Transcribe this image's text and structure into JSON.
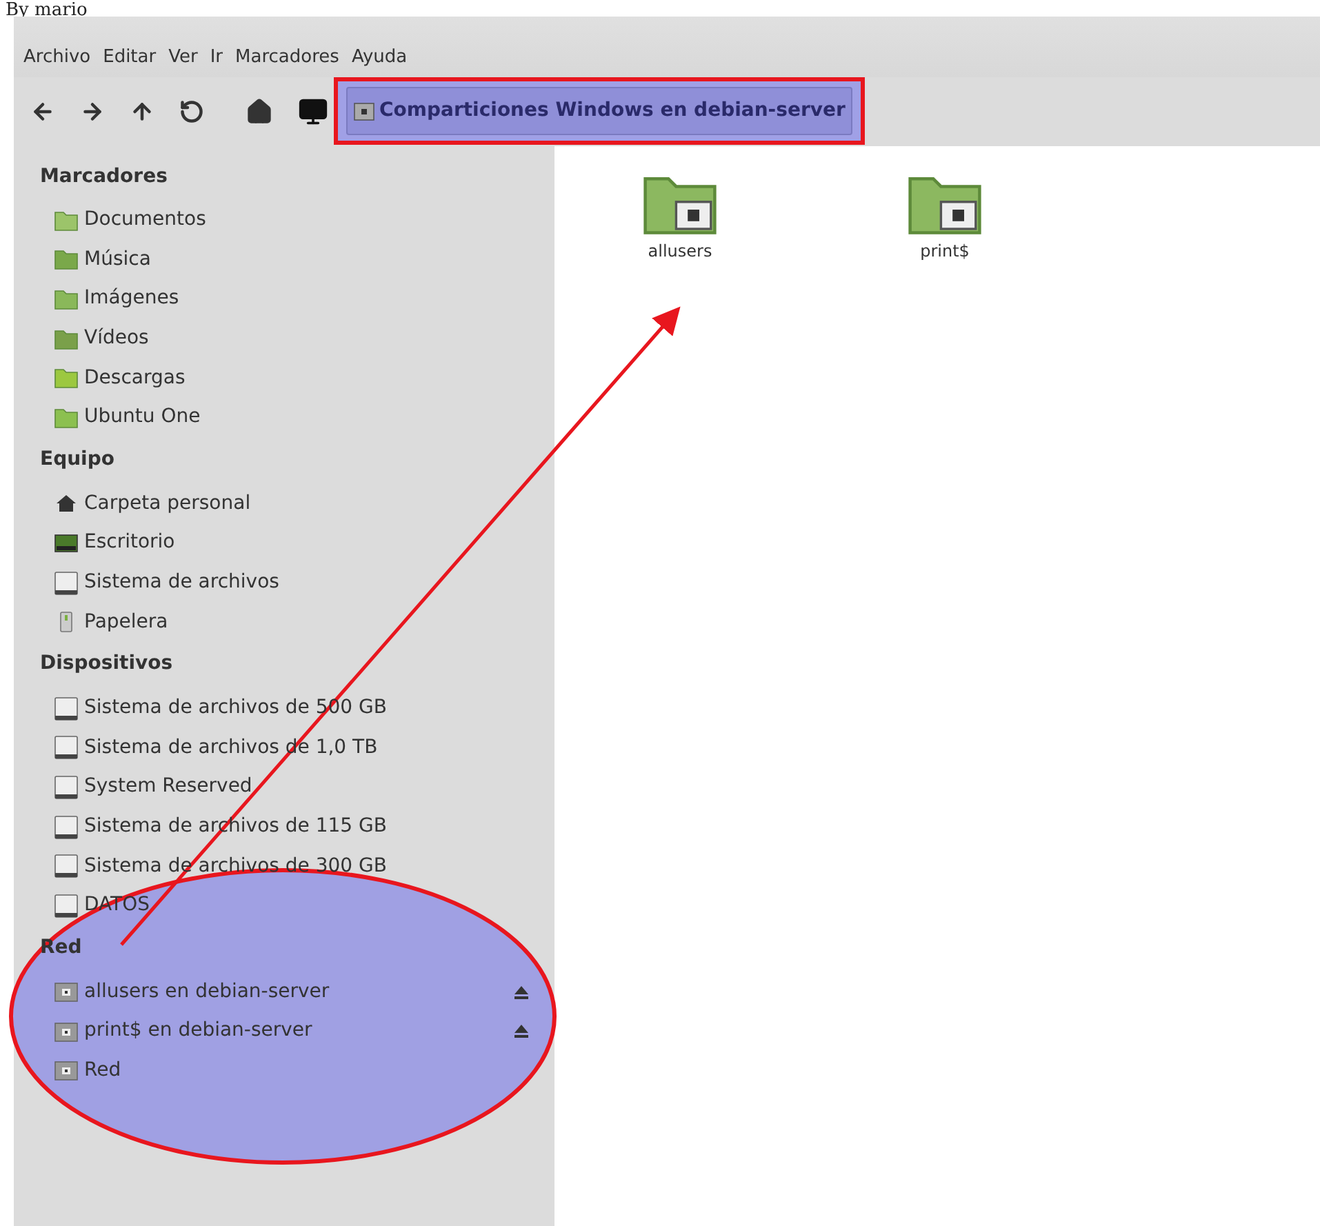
{
  "caption": "By mario",
  "menu": [
    "Archivo",
    "Editar",
    "Ver",
    "Ir",
    "Marcadores",
    "Ayuda"
  ],
  "location": {
    "label": "Comparticiones Windows en debian-server"
  },
  "sidebar": [
    {
      "title": "Marcadores",
      "items": [
        {
          "label": "Documentos",
          "ejectable": false
        },
        {
          "label": "Música",
          "ejectable": false
        },
        {
          "label": "Imágenes",
          "ejectable": false
        },
        {
          "label": "Vídeos",
          "ejectable": false
        },
        {
          "label": "Descargas",
          "ejectable": false
        },
        {
          "label": "Ubuntu One",
          "ejectable": false
        }
      ]
    },
    {
      "title": "Equipo",
      "items": [
        {
          "label": "Carpeta personal",
          "ejectable": false
        },
        {
          "label": "Escritorio",
          "ejectable": false
        },
        {
          "label": "Sistema de archivos",
          "ejectable": false
        },
        {
          "label": "Papelera",
          "ejectable": false
        }
      ]
    },
    {
      "title": "Dispositivos",
      "items": [
        {
          "label": "Sistema de archivos de 500 GB",
          "ejectable": false
        },
        {
          "label": "Sistema de archivos de 1,0 TB",
          "ejectable": false
        },
        {
          "label": "System Reserved",
          "ejectable": false
        },
        {
          "label": "Sistema de archivos de 115 GB",
          "ejectable": false
        },
        {
          "label": "Sistema de archivos de 300 GB",
          "ejectable": false
        },
        {
          "label": "DATOS",
          "ejectable": false
        }
      ]
    },
    {
      "title": "Red",
      "items": [
        {
          "label": "allusers en debian-server",
          "ejectable": true
        },
        {
          "label": "print$ en debian-server",
          "ejectable": true
        },
        {
          "label": "Red",
          "ejectable": false
        }
      ]
    }
  ],
  "files": [
    {
      "name": "allusers"
    },
    {
      "name": "print$"
    }
  ]
}
